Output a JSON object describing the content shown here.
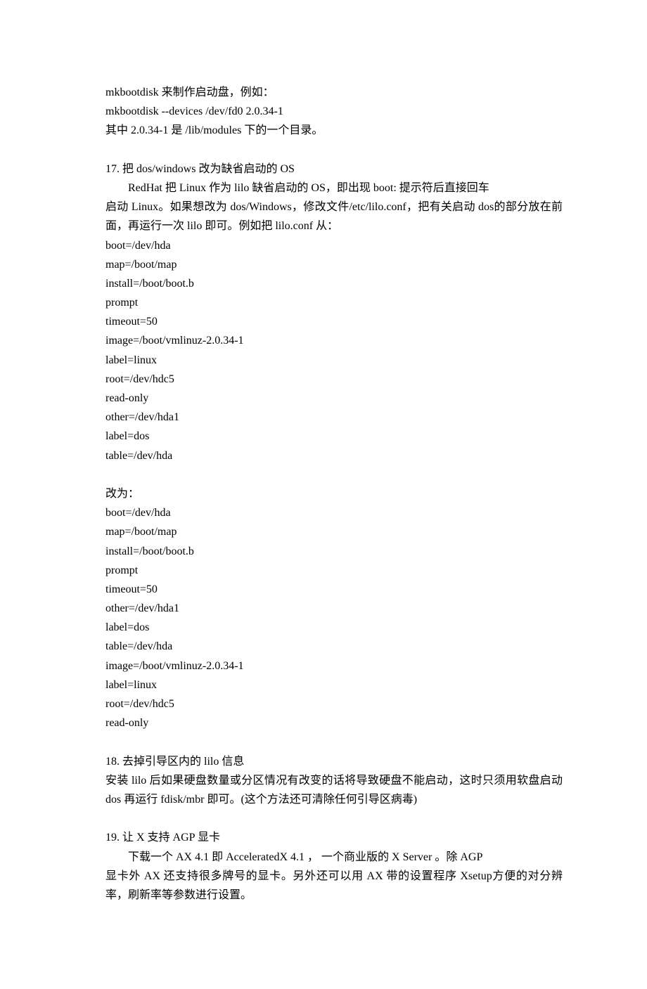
{
  "p01": "mkbootdisk 来制作启动盘，例如：",
  "p02": "mkbootdisk --devices /dev/fd0 2.0.34-1",
  "p03": "其中 2.0.34-1 是  /lib/modules 下的一个目录。",
  "p04": "17.  把 dos/windows 改为缺省启动的 OS",
  "p05_indent": "RedHat 把 Linux 作为 lilo 缺省启动的 OS，即出现  boot: 提示符后直接回车",
  "p06": "启动 Linux。如果想改为 dos/Windows，修改文件/etc/lilo.conf，把有关启动 dos的部分放在前面，再运行一次 lilo 即可。例如把 lilo.conf 从：",
  "p07": "boot=/dev/hda",
  "p08": "map=/boot/map",
  "p09": "install=/boot/boot.b",
  "p10": "prompt",
  "p11": "timeout=50",
  "p12": "image=/boot/vmlinuz-2.0.34-1",
  "p13": "label=linux",
  "p14": "root=/dev/hdc5",
  "p15": "read-only",
  "p16": "other=/dev/hda1",
  "p17": "label=dos",
  "p18": "table=/dev/hda",
  "p19": "改为：",
  "p20": "boot=/dev/hda",
  "p21": "map=/boot/map",
  "p22": "install=/boot/boot.b",
  "p23": "prompt",
  "p24": "timeout=50",
  "p25": "other=/dev/hda1",
  "p26": "label=dos",
  "p27": "table=/dev/hda",
  "p28": "image=/boot/vmlinuz-2.0.34-1",
  "p29": "label=linux",
  "p30": "root=/dev/hdc5",
  "p31": "read-only",
  "p32": "18.  去掉引导区内的 lilo 信息",
  "p33": "安装 lilo 后如果硬盘数量或分区情况有改变的话将导致硬盘不能启动，这时只须用软盘启动 dos 再运行  fdisk/mbr  即可。(这个方法还可清除任何引导区病毒)",
  "p34": "19.  让  X  支持  AGP  显卡",
  "p35_indent": "下载一个  AX 4.1 即  AcceleratedX 4.1 ，  一个商业版的  X Server 。除  AGP",
  "p36": "显卡外  AX  还支持很多牌号的显卡。另外还可以用 AX  带的设置程序  Xsetup方便的对分辨率，刷新率等参数进行设置。"
}
